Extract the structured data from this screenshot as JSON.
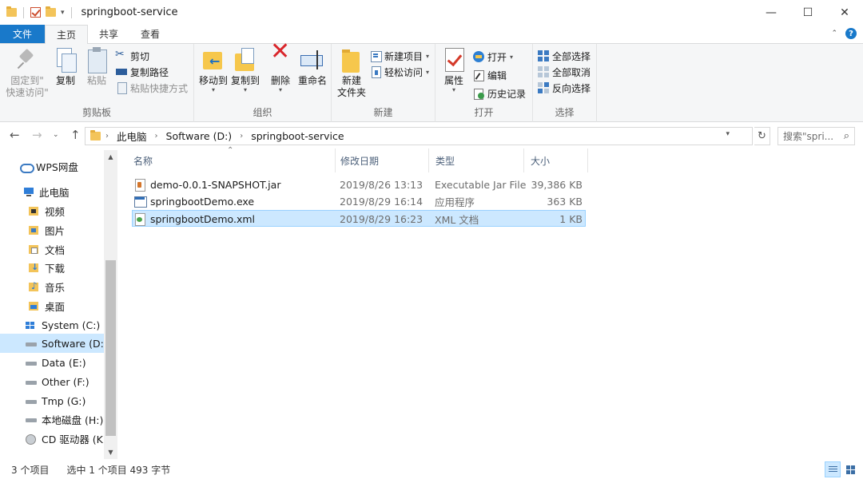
{
  "window": {
    "title": "springboot-service",
    "minimize": "—",
    "maximize": "☐",
    "close": "✕"
  },
  "ribbon_tabs": [
    {
      "label": "文件"
    },
    {
      "label": "主页"
    },
    {
      "label": "共享"
    },
    {
      "label": "查看"
    }
  ],
  "ribbon": {
    "clipboard": {
      "label": "剪贴板",
      "pin_line1": "固定到\"",
      "pin_line2": "快速访问\"",
      "copy": "复制",
      "paste": "粘贴",
      "cut": "剪切",
      "copy_path": "复制路径",
      "paste_shortcut": "粘贴快捷方式"
    },
    "organize": {
      "label": "组织",
      "move_to": "移动到",
      "copy_to": "复制到",
      "delete": "删除",
      "rename": "重命名"
    },
    "new": {
      "label": "新建",
      "new_item": "新建项目",
      "easy_access": "轻松访问",
      "new_folder_line1": "新建",
      "new_folder_line2": "文件夹"
    },
    "open": {
      "label": "打开",
      "properties": "属性",
      "open": "打开",
      "edit": "编辑",
      "history": "历史记录"
    },
    "select": {
      "label": "选择",
      "select_all": "全部选择",
      "select_none": "全部取消",
      "invert": "反向选择"
    }
  },
  "address": {
    "crumbs": [
      "此电脑",
      "Software (D:)",
      "springboot-service"
    ],
    "search_placeholder": "搜索\"spri..."
  },
  "nav": {
    "items": [
      {
        "label": "WPS网盘",
        "icon": "cloud-icon"
      },
      {
        "label": "此电脑",
        "icon": "computer-icon"
      },
      {
        "label": "视频",
        "icon": "videos-folder-icon"
      },
      {
        "label": "图片",
        "icon": "pictures-folder-icon"
      },
      {
        "label": "文档",
        "icon": "documents-folder-icon"
      },
      {
        "label": "下载",
        "icon": "downloads-folder-icon"
      },
      {
        "label": "音乐",
        "icon": "music-folder-icon"
      },
      {
        "label": "桌面",
        "icon": "desktop-folder-icon"
      },
      {
        "label": "System (C:)",
        "icon": "system-drive-icon"
      },
      {
        "label": "Software (D:)",
        "icon": "drive-icon"
      },
      {
        "label": "Data (E:)",
        "icon": "drive-icon"
      },
      {
        "label": "Other (F:)",
        "icon": "drive-icon"
      },
      {
        "label": "Tmp (G:)",
        "icon": "drive-icon"
      },
      {
        "label": "本地磁盘 (H:)",
        "icon": "drive-icon"
      },
      {
        "label": "CD 驱动器 (K:)",
        "icon": "cd-drive-icon"
      }
    ],
    "selected": "Software (D:)"
  },
  "filelist": {
    "columns": [
      "名称",
      "修改日期",
      "类型",
      "大小"
    ],
    "rows": [
      {
        "name": "demo-0.0.1-SNAPSHOT.jar",
        "date": "2019/8/26 13:13",
        "type": "Executable Jar File",
        "size": "39,386 KB",
        "icon": "jar-file-icon"
      },
      {
        "name": "springbootDemo.exe",
        "date": "2019/8/29 16:14",
        "type": "应用程序",
        "size": "363 KB",
        "icon": "exe-file-icon"
      },
      {
        "name": "springbootDemo.xml",
        "date": "2019/8/29 16:23",
        "type": "XML 文档",
        "size": "1 KB",
        "icon": "xml-file-icon"
      }
    ],
    "selected_row": 2
  },
  "status": {
    "count": "3 个项目",
    "selection": "选中 1 个项目  493 字节"
  },
  "colors": {
    "accent": "#1979ca",
    "selection": "#cce8ff"
  }
}
